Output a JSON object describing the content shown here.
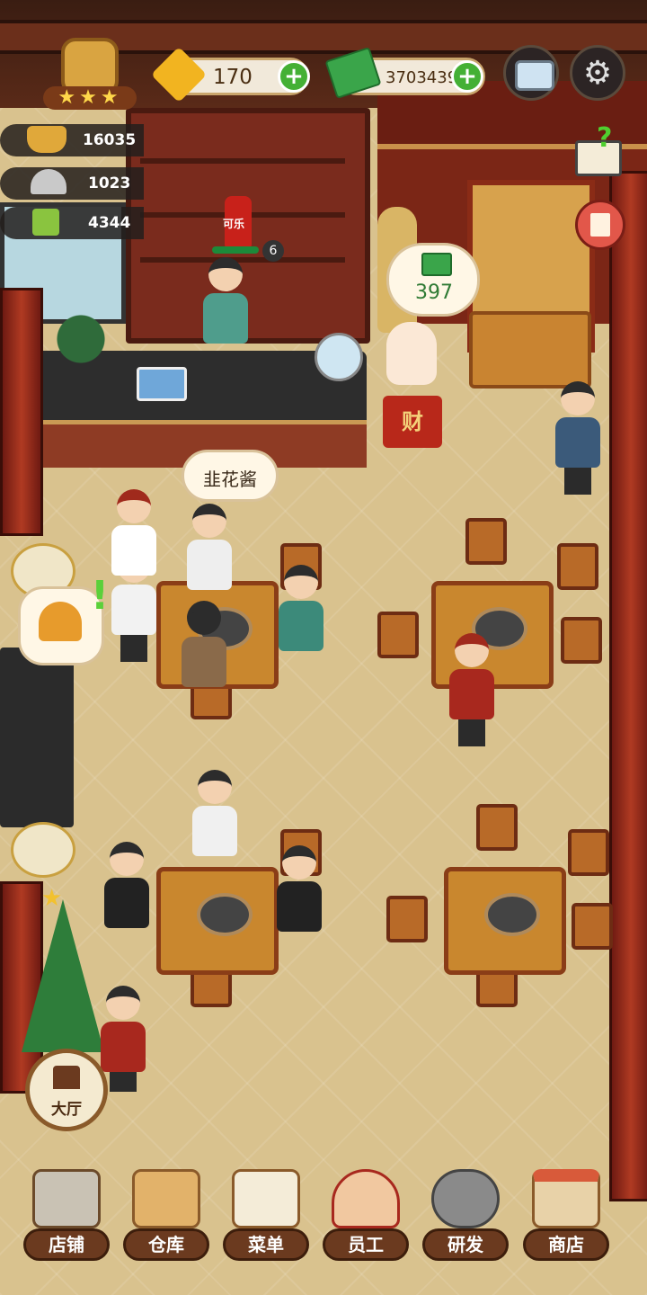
{
  "hud": {
    "gems": "170",
    "cash": "3703439",
    "stars": 3,
    "camera_icon": "camera-icon",
    "settings_icon": "gear-icon"
  },
  "stats": [
    {
      "icon": "hotpot-icon",
      "value": "16035"
    },
    {
      "icon": "serving-cloche-icon",
      "value": "1023"
    },
    {
      "icon": "menu-card-icon",
      "value": "4344"
    }
  ],
  "scene": {
    "cola_label": "可乐",
    "drink_stock": "6",
    "income_bubble": "397",
    "lucky_cat_sign": "财",
    "customer_order_bubble": "韭花酱"
  },
  "hall_button": {
    "label": "大厅"
  },
  "nav": [
    {
      "label": "店铺",
      "icon": "shop-building-icon"
    },
    {
      "label": "仓库",
      "icon": "warehouse-boxes-icon"
    },
    {
      "label": "菜单",
      "icon": "clipboard-menu-icon"
    },
    {
      "label": "员工",
      "icon": "staff-icon"
    },
    {
      "label": "研发",
      "icon": "wok-research-icon"
    },
    {
      "label": "商店",
      "icon": "store-icon"
    }
  ],
  "colors": {
    "plus_button": "#44b035",
    "nav_label_bg": "#6b3a1f",
    "hud_bg": "#fffaeb"
  }
}
